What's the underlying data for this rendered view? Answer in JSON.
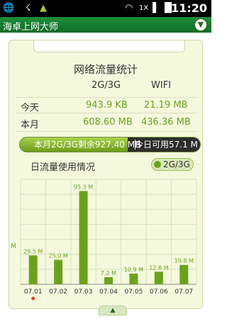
{
  "status_bar": {
    "time": "11:20",
    "icons": [
      "globe-icon",
      "usb-icon",
      "android-icon",
      "wifi-icon",
      "signal-icon",
      "battery-icon"
    ],
    "network_label": "1X"
  },
  "app": {
    "title": "海卓上网大师",
    "menu_icon": "chevron-down-icon"
  },
  "stats": {
    "header": "网络流量统计",
    "col_2g3g": "2G/3G",
    "col_wifi": "WIFI",
    "rows": [
      {
        "label": "今天",
        "mobile": "943.9 KB",
        "wifi": "21.19 MB"
      },
      {
        "label": "本月",
        "mobile": "608.60 MB",
        "wifi": "436.36 MB"
      }
    ],
    "quota": {
      "left_text": "本月2G/3G剩余927.40 MB",
      "right_text": "今日可用57.1 M",
      "fraction": 0.6
    }
  },
  "daily": {
    "title": "日流量使用情况",
    "toggle_label": "2G/3G"
  },
  "chart_data": {
    "type": "bar",
    "categories": [
      "07.01",
      "07.02",
      "07.03",
      "07.04",
      "07.05",
      "07.06",
      "07.07"
    ],
    "values": [
      29.5,
      25.0,
      95.3,
      7.2,
      10.9,
      12.8,
      19.8
    ],
    "value_labels": [
      "29.5 M",
      "25.0 M",
      "95.3 M",
      "7.2 M",
      "10.9 M",
      "12.8 M",
      "19.8 M"
    ],
    "ylim": [
      0,
      100
    ],
    "y_tick_label": "M",
    "highlight_index": 0,
    "colors": {
      "bar": "#6aa31b",
      "today_dot": "#e8401c"
    },
    "grid": true
  }
}
